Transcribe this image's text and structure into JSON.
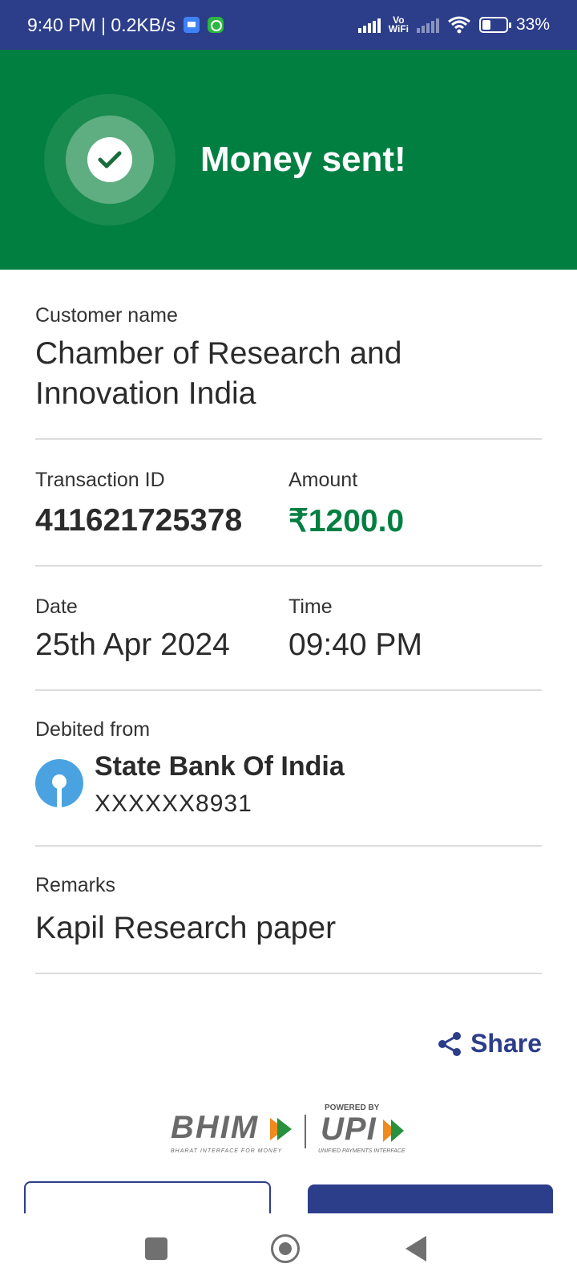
{
  "status_bar": {
    "time_speed": "9:40 PM | 0.2KB/s",
    "vowifi_top": "Vo",
    "vowifi_bottom": "WiFi",
    "battery": "33%"
  },
  "header": {
    "title": "Money sent!"
  },
  "customer": {
    "label": "Customer name",
    "value_line1": "Chamber of Research and",
    "value_line2": "Innovation India"
  },
  "transaction": {
    "id_label": "Transaction ID",
    "id_value": "411621725378",
    "amount_label": "Amount",
    "amount_value": "₹1200.0"
  },
  "datetime": {
    "date_label": "Date",
    "date_value": "25th Apr 2024",
    "time_label": "Time",
    "time_value": "09:40 PM"
  },
  "debited": {
    "label": "Debited from",
    "bank_name": "State Bank Of India",
    "account": "XXXXXX8931"
  },
  "remarks": {
    "label": "Remarks",
    "value": "Kapil Research paper"
  },
  "actions": {
    "share_label": "Share"
  },
  "branding": {
    "bhim": "BHIM",
    "bhim_tagline": "BHARAT INTERFACE FOR MONEY",
    "powered_by": "POWERED BY",
    "upi": "UPI",
    "upi_tagline": "UNIFIED PAYMENTS INTERFACE"
  },
  "colors": {
    "header_green": "#007f41",
    "brand_blue": "#2c3d8a",
    "amount_green": "#007f41"
  }
}
